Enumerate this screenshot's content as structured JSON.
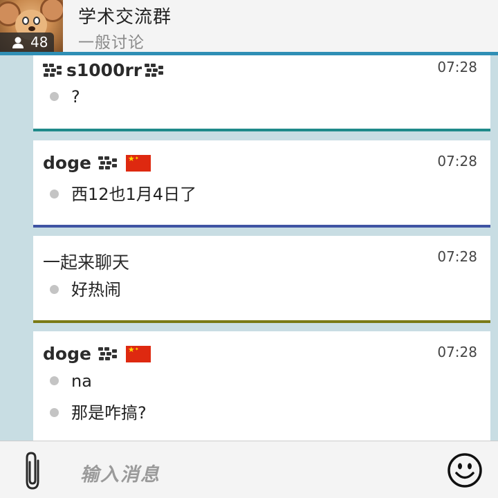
{
  "header": {
    "title": "学术交流群",
    "subtitle": "一般讨论",
    "member_count": "48"
  },
  "messages": [
    {
      "sender": "s1000rr",
      "sender_prefix_icon": "bbm-icon",
      "sender_suffix_icon": "bbm-icon",
      "time": "07:28",
      "lines": [
        "?"
      ],
      "bar_color": "#1f8a8a"
    },
    {
      "sender": "doge",
      "sender_suffix_icon": "bbm-icon",
      "flag": "china-flag-icon",
      "time": "07:28",
      "lines": [
        "西12也1月4日了"
      ],
      "bar_color": "#3f54a3"
    },
    {
      "sender": "一起来聊天",
      "time": "07:28",
      "lines": [
        "好热闹"
      ],
      "bar_color": "#7a7a16"
    },
    {
      "sender": "doge",
      "sender_suffix_icon": "bbm-icon",
      "flag": "china-flag-icon",
      "time": "07:28",
      "lines": [
        "na",
        "那是咋搞?"
      ],
      "bar_color": ""
    }
  ],
  "composer": {
    "placeholder": "输入消息",
    "attach_icon": "paperclip-icon",
    "emoji_icon": "smiley-icon"
  },
  "colors": {
    "header_line": "#2f8fb5",
    "background": "#c8dde3"
  }
}
